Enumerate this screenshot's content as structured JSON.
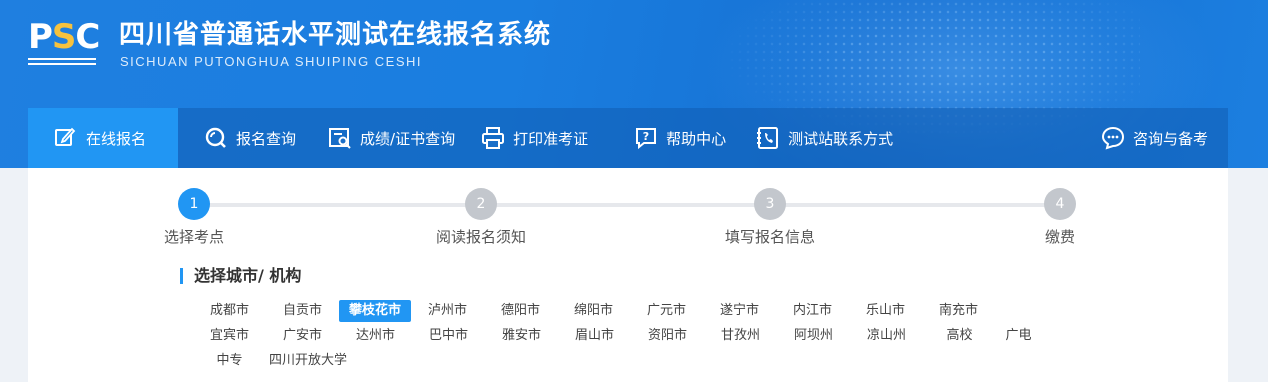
{
  "header": {
    "logo_text_p": "P",
    "logo_text_s": "S",
    "logo_text_c": "C",
    "title": "四川省普通话水平测试在线报名系统",
    "subtitle": "SICHUAN PUTONGHUA SHUIPING CESHI"
  },
  "nav": {
    "items": [
      {
        "label": "在线报名",
        "icon": "edit-icon"
      },
      {
        "label": "报名查询",
        "icon": "search-icon"
      },
      {
        "label": "成绩/证书查询",
        "icon": "certificate-search-icon"
      },
      {
        "label": "打印准考证",
        "icon": "printer-icon"
      },
      {
        "label": "帮助中心",
        "icon": "help-icon"
      },
      {
        "label": "测试站联系方式",
        "icon": "phone-book-icon"
      }
    ],
    "right": {
      "label": "咨询与备考",
      "icon": "chat-icon"
    }
  },
  "steps": [
    {
      "num": "1",
      "label": "选择考点",
      "active": true
    },
    {
      "num": "2",
      "label": "阅读报名须知",
      "active": false
    },
    {
      "num": "3",
      "label": "填写报名信息",
      "active": false
    },
    {
      "num": "4",
      "label": "缴费",
      "active": false
    }
  ],
  "section": {
    "title": "选择城市/ 机构"
  },
  "cities": {
    "row1": [
      "成都市",
      "自贡市",
      "攀枝花市",
      "泸州市",
      "德阳市",
      "绵阳市",
      "广元市",
      "遂宁市",
      "内江市",
      "乐山市",
      "南充市"
    ],
    "row2": [
      "宜宾市",
      "广安市",
      "达州市",
      "巴中市",
      "雅安市",
      "眉山市",
      "资阳市",
      "甘孜州",
      "阿坝州",
      "凉山州",
      "高校",
      "广电"
    ],
    "row3": [
      "中专",
      "四川开放大学"
    ],
    "selected": "攀枝花市"
  },
  "colors": {
    "accent": "#2196f3",
    "banner": "#1a7ee0",
    "inactive_step": "#c3c7cd"
  }
}
